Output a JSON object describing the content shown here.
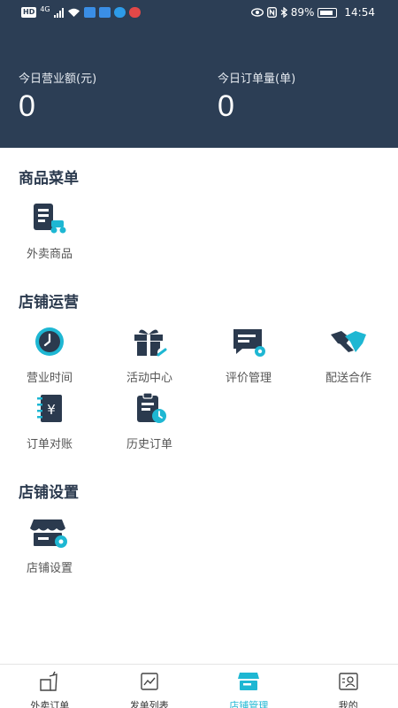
{
  "status_bar": {
    "network": "HD",
    "network_gen": "4G",
    "battery": "89%",
    "time": "14:54"
  },
  "header": {
    "stats": [
      {
        "label": "今日营业额(元)",
        "value": "0"
      },
      {
        "label": "今日订单量(单)",
        "value": "0"
      }
    ]
  },
  "sections": [
    {
      "title": "商品菜单",
      "items": [
        {
          "label": "外卖商品",
          "icon": "takeout-goods-icon"
        }
      ]
    },
    {
      "title": "店铺运营",
      "items": [
        {
          "label": "营业时间",
          "icon": "clock-icon"
        },
        {
          "label": "活动中心",
          "icon": "gift-icon"
        },
        {
          "label": "评价管理",
          "icon": "comment-settings-icon"
        },
        {
          "label": "配送合作",
          "icon": "handshake-icon"
        },
        {
          "label": "订单对账",
          "icon": "yuan-notebook-icon"
        },
        {
          "label": "历史订单",
          "icon": "history-clipboard-icon"
        }
      ]
    },
    {
      "title": "店铺设置",
      "items": [
        {
          "label": "店铺设置",
          "icon": "store-settings-icon"
        }
      ]
    }
  ],
  "tabbar": {
    "items": [
      {
        "label": "外卖订单",
        "icon": "takeout-order-icon"
      },
      {
        "label": "发单列表",
        "icon": "list-icon"
      },
      {
        "label": "店铺管理",
        "icon": "store-icon",
        "active": true
      },
      {
        "label": "我的",
        "icon": "profile-icon"
      }
    ]
  },
  "colors": {
    "header_bg": "#2c3e55",
    "icon_dark": "#2b3a4e",
    "accent": "#1eb7d3"
  }
}
